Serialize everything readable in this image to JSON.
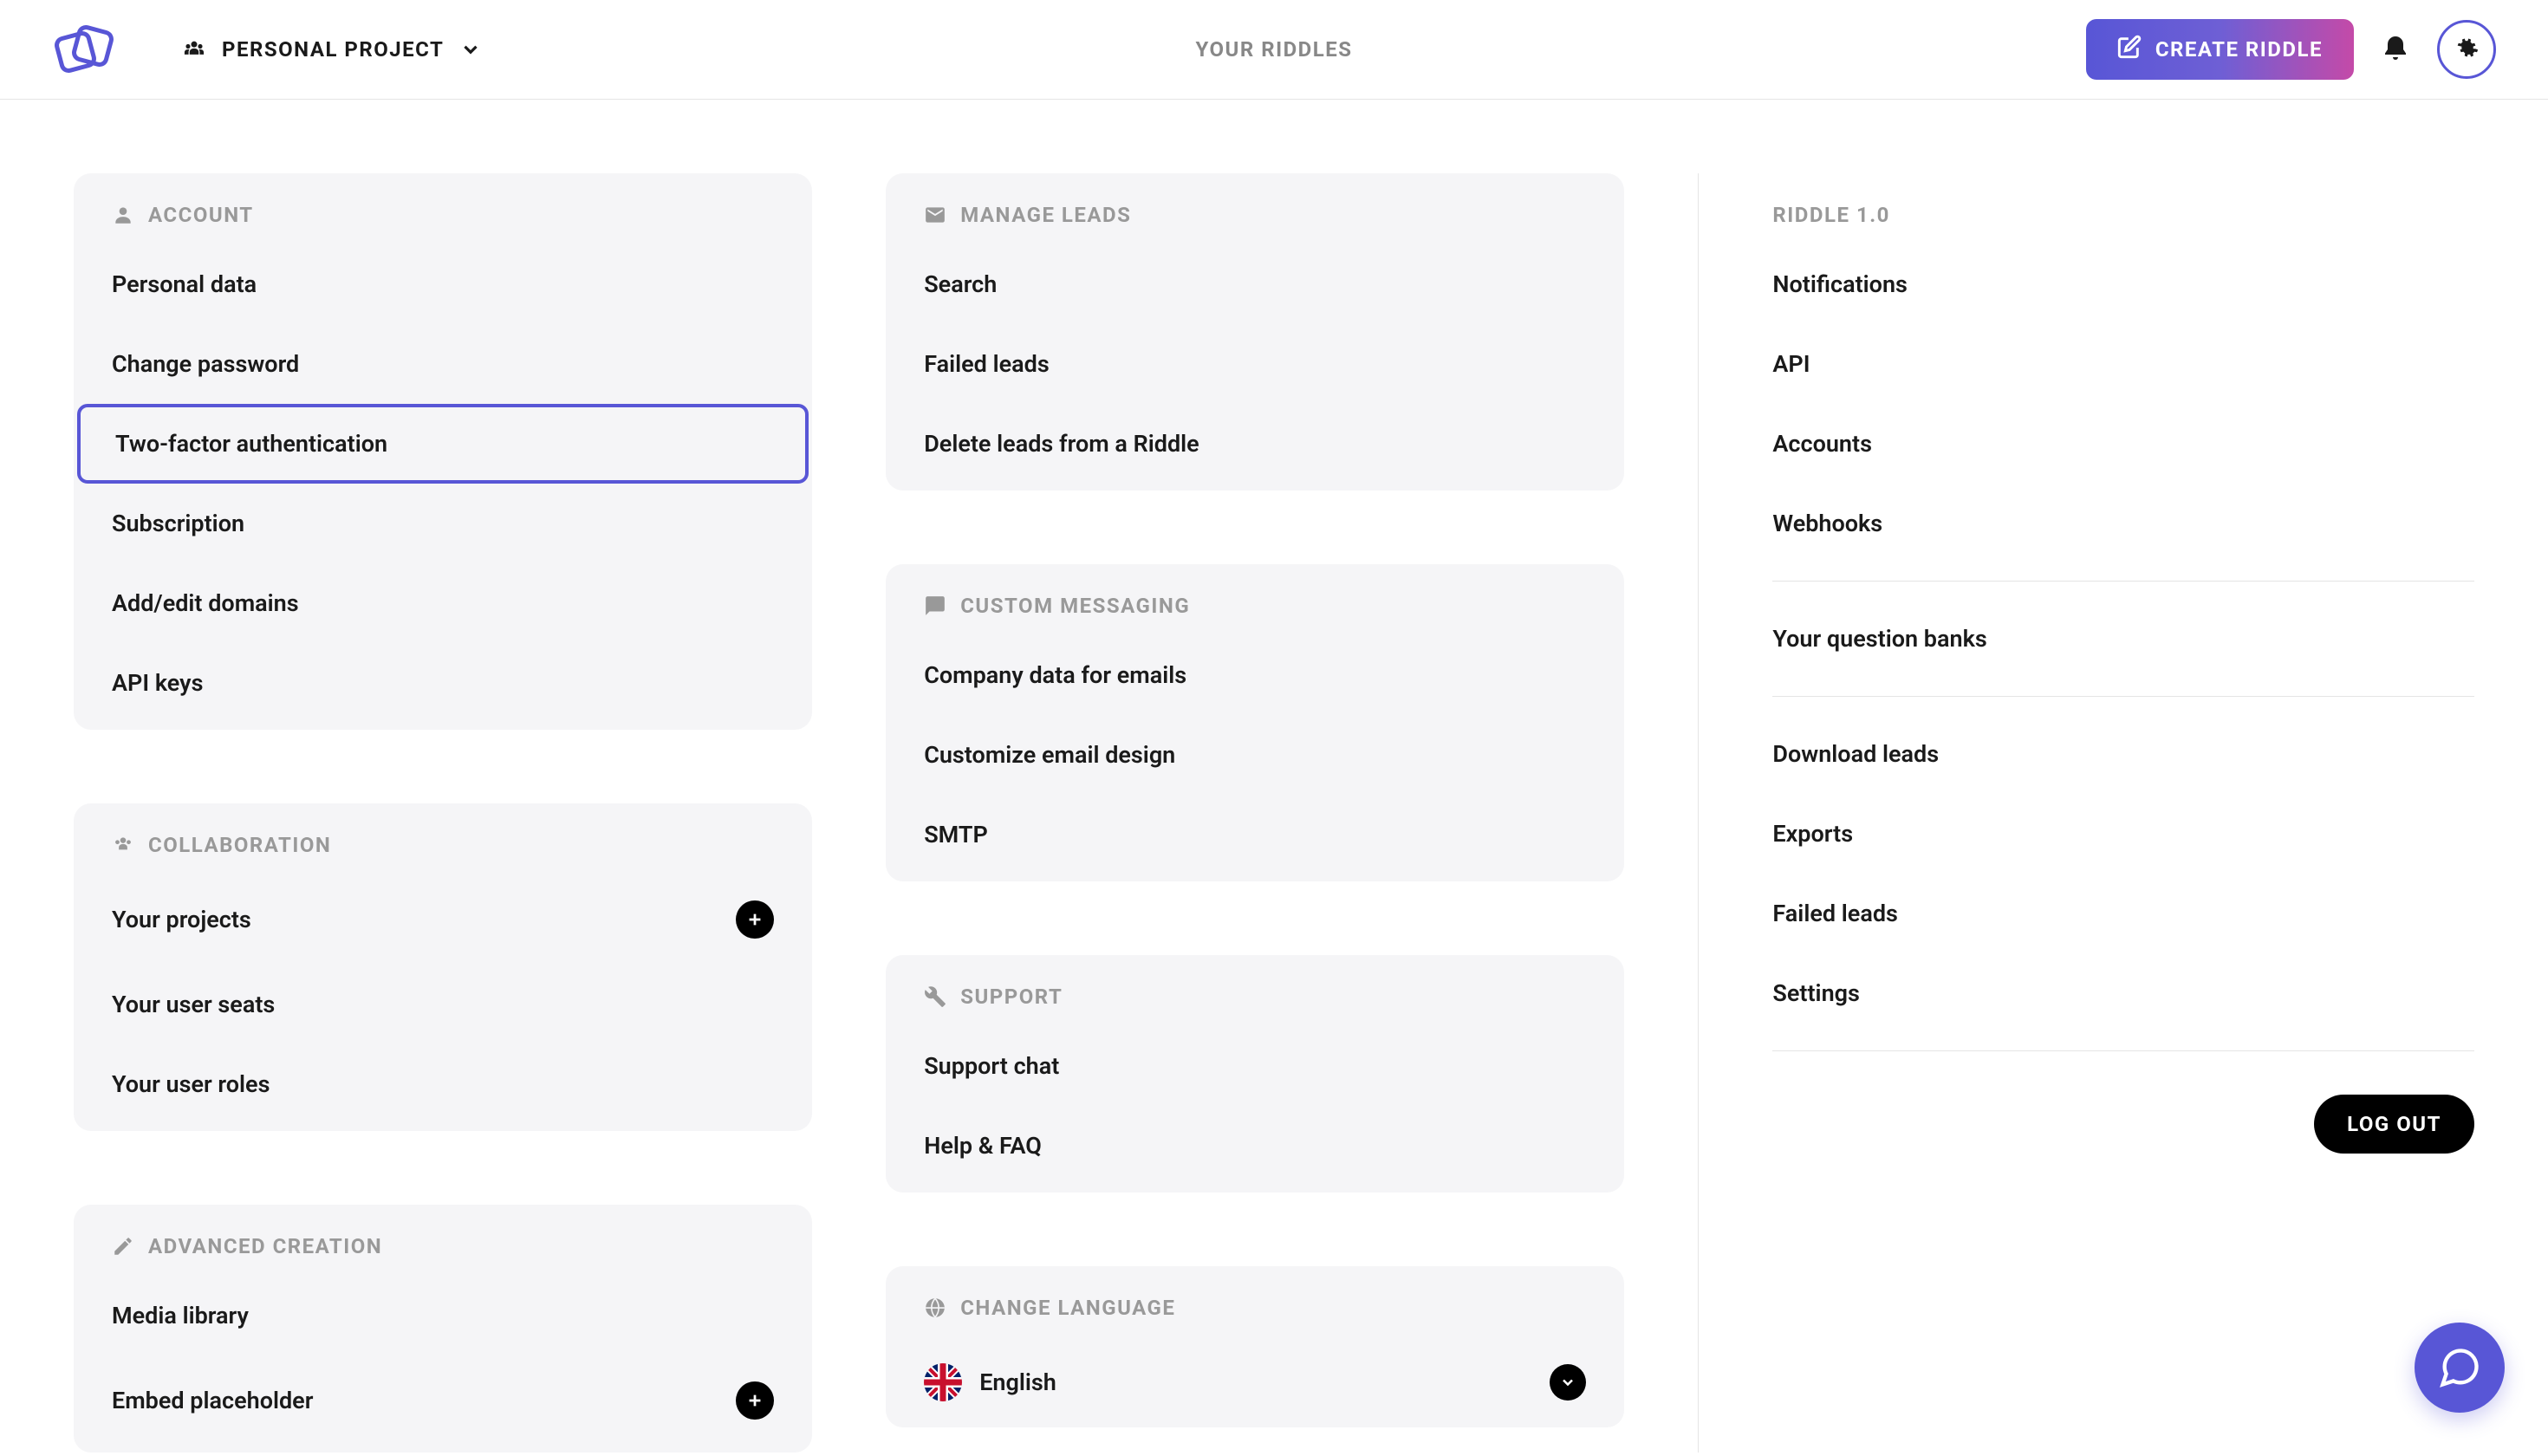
{
  "header": {
    "project_name": "PERSONAL PROJECT",
    "page_title": "YOUR RIDDLES",
    "create_label": "CREATE RIDDLE"
  },
  "account": {
    "title": "ACCOUNT",
    "items": [
      "Personal data",
      "Change password",
      "Two-factor authentication",
      "Subscription",
      "Add/edit domains",
      "API keys"
    ],
    "selected_index": 2
  },
  "collaboration": {
    "title": "COLLABORATION",
    "items": [
      {
        "label": "Your projects",
        "has_plus": true
      },
      {
        "label": "Your user seats",
        "has_plus": false
      },
      {
        "label": "Your user roles",
        "has_plus": false
      }
    ]
  },
  "advanced": {
    "title": "ADVANCED CREATION",
    "items": [
      {
        "label": "Media library",
        "has_plus": false
      },
      {
        "label": "Embed placeholder",
        "has_plus": true
      }
    ]
  },
  "manage_leads": {
    "title": "MANAGE LEADS",
    "items": [
      "Search",
      "Failed leads",
      "Delete leads from a Riddle"
    ]
  },
  "custom_messaging": {
    "title": "CUSTOM MESSAGING",
    "items": [
      "Company data for emails",
      "Customize email design",
      "SMTP"
    ]
  },
  "support": {
    "title": "SUPPORT",
    "items": [
      "Support chat",
      "Help & FAQ"
    ]
  },
  "language": {
    "title": "CHANGE LANGUAGE",
    "current": "English"
  },
  "riddle10": {
    "title": "RIDDLE 1.0",
    "items": [
      "Notifications",
      "API",
      "Accounts",
      "Webhooks"
    ]
  },
  "question_banks": "Your question banks",
  "downloads": {
    "items": [
      "Download leads",
      "Exports",
      "Failed leads",
      "Settings"
    ]
  },
  "logout": "LOG OUT"
}
